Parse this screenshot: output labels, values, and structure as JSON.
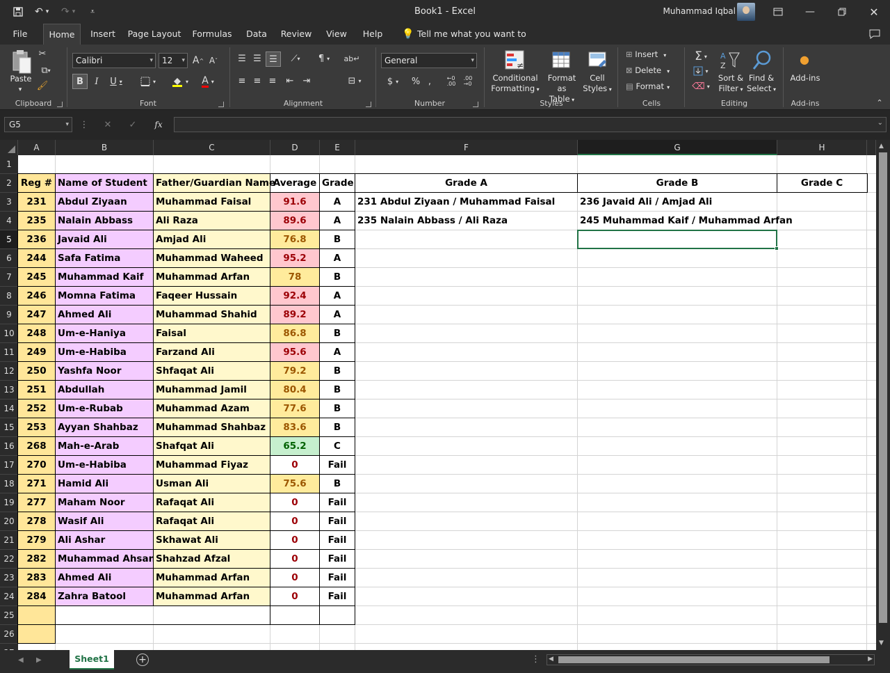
{
  "window": {
    "title": "Book1  -  Excel",
    "user": "Muhammad Iqbal"
  },
  "tabs": [
    "File",
    "Home",
    "Insert",
    "Page Layout",
    "Formulas",
    "Data",
    "Review",
    "View",
    "Help"
  ],
  "tell_me": "Tell me what you want to do",
  "ribbon": {
    "clipboard": {
      "label": "Clipboard",
      "paste": "Paste"
    },
    "font": {
      "label": "Font",
      "name": "Calibri",
      "size": "12"
    },
    "alignment": {
      "label": "Alignment"
    },
    "number": {
      "label": "Number",
      "format": "General"
    },
    "styles": {
      "label": "Styles",
      "conditional": "Conditional",
      "formatting": "Formatting",
      "format_as": "Format as",
      "table": "Table",
      "cell": "Cell",
      "cell_styles": "Styles"
    },
    "cells": {
      "label": "Cells",
      "insert": "Insert",
      "delete": "Delete",
      "format": "Format"
    },
    "editing": {
      "label": "Editing",
      "sort": "Sort &",
      "filter": "Filter",
      "find": "Find &",
      "select": "Select"
    },
    "addins": {
      "label": "Add-ins",
      "button": "Add-ins"
    }
  },
  "name_box": "G5",
  "columns": [
    "A",
    "B",
    "C",
    "D",
    "E",
    "F",
    "G",
    "H"
  ],
  "header_row": {
    "reg": "Reg #",
    "name": "Name of Student",
    "father": "Father/Guardian Name",
    "avg": "Average",
    "grade": "Grade",
    "ga": "Grade A",
    "gb": "Grade B",
    "gc": "Grade C"
  },
  "rows": [
    {
      "reg": "231",
      "name": "Abdul Ziyaan",
      "father": "Muhammad Faisal",
      "avg": "91.6",
      "grade": "A",
      "f": "231 Abdul Ziyaan / Muhammad Faisal",
      "g": "236 Javaid Ali / Amjad Ali"
    },
    {
      "reg": "235",
      "name": "Nalain Abbass",
      "father": "Ali Raza",
      "avg": "89.6",
      "grade": "A",
      "f": "235 Nalain Abbass / Ali Raza",
      "g": "245 Muhammad Kaif / Muhammad Arfan"
    },
    {
      "reg": "236",
      "name": "Javaid Ali",
      "father": "Amjad Ali",
      "avg": "76.8",
      "grade": "B",
      "f": "",
      "g": ""
    },
    {
      "reg": "244",
      "name": "Safa Fatima",
      "father": "Muhammad Waheed",
      "avg": "95.2",
      "grade": "A",
      "f": "",
      "g": ""
    },
    {
      "reg": "245",
      "name": "Muhammad Kaif",
      "father": "Muhammad Arfan",
      "avg": "78",
      "grade": "B",
      "f": "",
      "g": ""
    },
    {
      "reg": "246",
      "name": "Momna Fatima",
      "father": "Faqeer Hussain",
      "avg": "92.4",
      "grade": "A",
      "f": "",
      "g": ""
    },
    {
      "reg": "247",
      "name": "Ahmed Ali",
      "father": "Muhammad Shahid",
      "avg": "89.2",
      "grade": "A",
      "f": "",
      "g": ""
    },
    {
      "reg": "248",
      "name": "Um-e-Haniya",
      "father": "Faisal",
      "avg": "86.8",
      "grade": "B",
      "f": "",
      "g": ""
    },
    {
      "reg": "249",
      "name": "Um-e-Habiba",
      "father": "Farzand Ali",
      "avg": "95.6",
      "grade": "A",
      "f": "",
      "g": ""
    },
    {
      "reg": "250",
      "name": "Yashfa Noor",
      "father": "Shfaqat Ali",
      "avg": "79.2",
      "grade": "B",
      "f": "",
      "g": ""
    },
    {
      "reg": "251",
      "name": "Abdullah",
      "father": "Muhammad Jamil",
      "avg": "80.4",
      "grade": "B",
      "f": "",
      "g": ""
    },
    {
      "reg": "252",
      "name": "Um-e-Rubab",
      "father": "Muhammad Azam",
      "avg": "77.6",
      "grade": "B",
      "f": "",
      "g": ""
    },
    {
      "reg": "253",
      "name": "Ayyan Shahbaz",
      "father": "Muhammad Shahbaz",
      "avg": "83.6",
      "grade": "B",
      "f": "",
      "g": ""
    },
    {
      "reg": "268",
      "name": "Mah-e-Arab",
      "father": "Shafqat Ali",
      "avg": "65.2",
      "grade": "C",
      "f": "",
      "g": ""
    },
    {
      "reg": "270",
      "name": "Um-e-Habiba",
      "father": "Muhammad Fiyaz",
      "avg": "0",
      "grade": "Fail",
      "f": "",
      "g": ""
    },
    {
      "reg": "271",
      "name": "Hamid Ali",
      "father": "Usman Ali",
      "avg": "75.6",
      "grade": "B",
      "f": "",
      "g": ""
    },
    {
      "reg": "277",
      "name": "Maham Noor",
      "father": "Rafaqat Ali",
      "avg": "0",
      "grade": "Fail",
      "f": "",
      "g": ""
    },
    {
      "reg": "278",
      "name": "Wasif Ali",
      "father": "Rafaqat Ali",
      "avg": "0",
      "grade": "Fail",
      "f": "",
      "g": ""
    },
    {
      "reg": "279",
      "name": "Ali Ashar",
      "father": "Skhawat Ali",
      "avg": "0",
      "grade": "Fail",
      "f": "",
      "g": ""
    },
    {
      "reg": "282",
      "name": "Muhammad Ahsan",
      "father": "Shahzad Afzal",
      "avg": "0",
      "grade": "Fail",
      "f": "",
      "g": ""
    },
    {
      "reg": "283",
      "name": "Ahmed Ali",
      "father": "Muhammad Arfan",
      "avg": "0",
      "grade": "Fail",
      "f": "",
      "g": ""
    },
    {
      "reg": "284",
      "name": "Zahra Batool",
      "father": "Muhammad Arfan",
      "avg": "0",
      "grade": "Fail",
      "f": "",
      "g": ""
    }
  ],
  "sheet_tab": "Sheet1",
  "colors": {
    "reg_fill": "#ffe699",
    "name_fill": "#f4ccff",
    "father_fill": "#fff8cc",
    "red_fill": "#ffc7ce",
    "red_text": "#9c0006",
    "yellow_fill": "#ffeb9c",
    "yellow_text": "#9c5700",
    "green_fill": "#c6efce",
    "green_text": "#006100",
    "accent": "#217346"
  }
}
